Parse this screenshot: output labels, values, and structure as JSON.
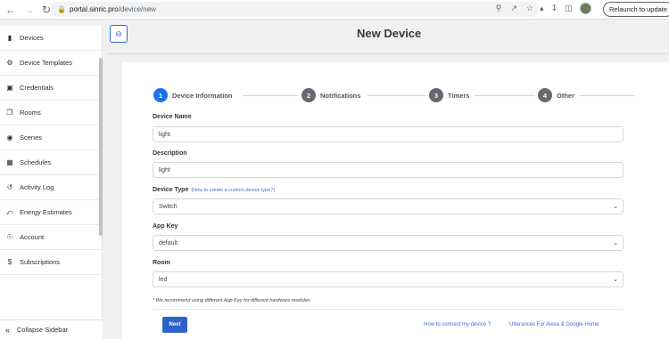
{
  "browser": {
    "url_host": "portal.sinric.pro",
    "url_path": "/device/new",
    "relaunch_label": "Relaunch to update"
  },
  "sidebar": {
    "items": [
      {
        "label": "Devices",
        "icon": "phone-icon"
      },
      {
        "label": "Device Templates",
        "icon": "wrench-icon"
      },
      {
        "label": "Credentials",
        "icon": "lock-icon"
      },
      {
        "label": "Rooms",
        "icon": "copy-icon"
      },
      {
        "label": "Scenes",
        "icon": "dot-circle-icon"
      },
      {
        "label": "Schedules",
        "icon": "calendar-icon"
      },
      {
        "label": "Activity Log",
        "icon": "history-icon"
      },
      {
        "label": "Energy Estimates",
        "icon": "bolt-icon"
      },
      {
        "label": "Account",
        "icon": "user-icon"
      },
      {
        "label": "Subscriptions",
        "icon": "dollar-icon"
      }
    ],
    "collapse_label": "Collapse Sidebar"
  },
  "page": {
    "title": "New Device"
  },
  "stepper": {
    "steps": [
      {
        "num": "1",
        "label": "Device Information",
        "active": true
      },
      {
        "num": "2",
        "label": "Notifications",
        "active": false
      },
      {
        "num": "3",
        "label": "Timers",
        "active": false
      },
      {
        "num": "4",
        "label": "Other",
        "active": false
      }
    ]
  },
  "form": {
    "device_name": {
      "label": "Device Name",
      "value": "light"
    },
    "description": {
      "label": "Description",
      "value": "light"
    },
    "device_type": {
      "label": "Device Type",
      "hint": "(How to create a custom device type?)",
      "value": "Switch"
    },
    "app_key": {
      "label": "App Key",
      "value": "default"
    },
    "room": {
      "label": "Room",
      "value": "led"
    },
    "note": "* We recommend using different App Key for different hardware modules",
    "next_label": "Next",
    "link_connect": "How to connect my device ?",
    "link_utterances": "Utterances For Alexa & Google Home"
  },
  "colors": {
    "accent": "#1a73e8",
    "button": "#2e63c9",
    "link": "#3b6fd0"
  }
}
